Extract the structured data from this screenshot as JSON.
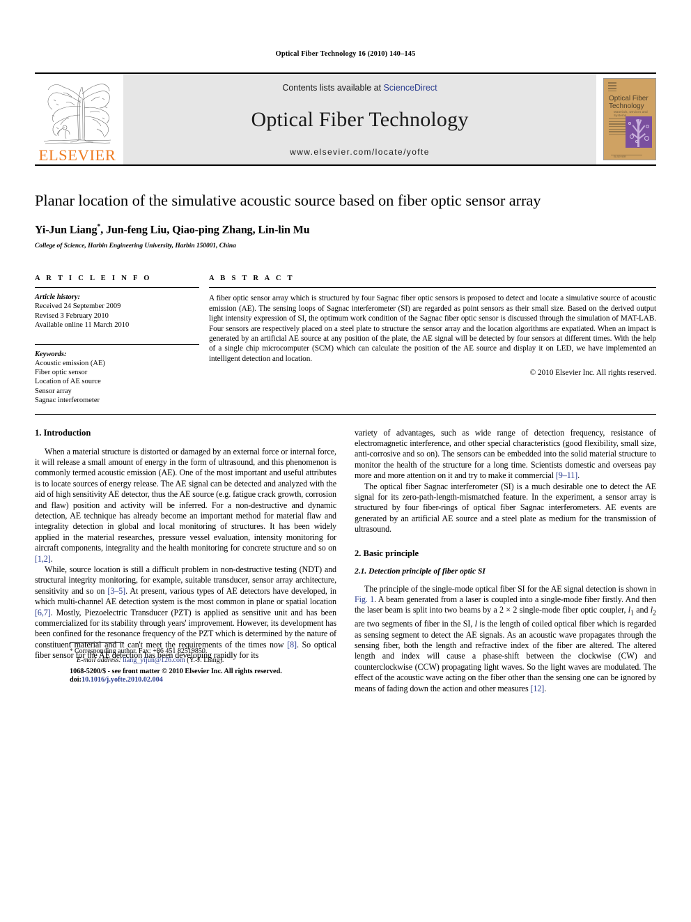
{
  "running_head": "Optical Fiber Technology 16 (2010) 140–145",
  "masthead": {
    "publisher_name": "ELSEVIER",
    "contents_prefix": "Contents lists available at ",
    "sciencedirect": "ScienceDirect",
    "journal_title": "Optical Fiber Technology",
    "journal_url": "www.elsevier.com/locate/yofte",
    "cover": {
      "title_line1": "Optical Fiber",
      "title_line2": "Technology",
      "subtitle": "Materials, Devices and Systems",
      "footer": "ELSEVIER"
    }
  },
  "article": {
    "title": "Planar location of the simulative acoustic source based on fiber optic sensor array",
    "authors": "Yi-Jun Liang *, Jun-feng Liu, Qiao-ping Zhang, Lin-lin Mu",
    "affiliation": "College of Science, Harbin Engineering University, Harbin 150001, China"
  },
  "article_info": {
    "heading": "A R T I C L E   I N F O",
    "history_label": "Article history:",
    "history": [
      "Received 24 September 2009",
      "Revised 3 February 2010",
      "Available online 11 March 2010"
    ],
    "keywords_label": "Keywords:",
    "keywords": [
      "Acoustic emission (AE)",
      "Fiber optic sensor",
      "Location of AE source",
      "Sensor array",
      "Sagnac interferometer"
    ]
  },
  "abstract": {
    "heading": "A B S T R A C T",
    "text": "A fiber optic sensor array which is structured by four Sagnac fiber optic sensors is proposed to detect and locate a simulative source of acoustic emission (AE). The sensing loops of Sagnac interferometer (SI) are regarded as point sensors as their small size. Based on the derived output light intensity expression of SI, the optimum work condition of the Sagnac fiber optic sensor is discussed through the simulation of MAT-LAB. Four sensors are respectively placed on a steel plate to structure the sensor array and the location algorithms are expatiated. When an impact is generated by an artificial AE source at any position of the plate, the AE signal will be detected by four sensors at different times. With the help of a single chip microcomputer (SCM) which can calculate the position of the AE source and display it on LED, we have implemented an intelligent detection and location.",
    "copyright": "© 2010 Elsevier Inc. All rights reserved."
  },
  "sections": {
    "introduction_heading": "1. Introduction",
    "basic_principle_heading": "2. Basic principle",
    "subsection_2_1_heading": "2.1. Detection principle of fiber optic SI"
  },
  "body": {
    "left": {
      "p1_a": "When a material structure is distorted or damaged by an external force or internal force, it will release a small amount of energy in the form of ultrasound, and this phenomenon is commonly termed acoustic emission (AE). One of the most important and useful attributes is to locate sources of energy release. The AE signal can be detected and analyzed with the aid of high sensitivity AE detector, thus the AE source (e.g. fatigue crack growth, corrosion and flaw) position and activity will be inferred. For a non-destructive and dynamic detection, AE technique has already become an important method for material flaw and integrality detection in global and local monitoring of structures. It has been widely applied in the material researches, pressure vessel evaluation, intensity monitoring for aircraft components, integrality and the health monitoring for concrete structure and so on ",
      "p1_ref": "[1,2]",
      "p1_b": ".",
      "p2_a": "While, source location is still a difficult problem in non-destructive testing (NDT) and structural integrity monitoring, for example, suitable transducer, sensor array architecture, sensitivity and so on ",
      "p2_ref1": "[3–5]",
      "p2_b": ". At present, various types of AE detectors have developed, in which multi-channel AE detection system is the most common in plane or spatial location ",
      "p2_ref2": "[6,7]",
      "p2_c": ". Mostly, Piezoelectric Transducer (PZT) is applied as sensitive unit and has been commercialized for its stability through years' improvement. However, its development has been confined for the resonance frequency of the PZT which is determined by the nature of constituent material and it can't meet the requirements of the times now ",
      "p2_ref3": "[8]",
      "p2_d": ". So optical fiber sensor for the AE detection has been developing rapidly for its"
    },
    "right": {
      "p1_a": "variety of advantages, such as wide range of detection frequency, resistance of electromagnetic interference, and other special characteristics (good flexibility, small size, anti-corrosive and so on). The sensors can be embedded into the solid material structure to monitor the health of the structure for a long time. Scientists domestic and overseas pay more and more attention on it and try to make it commercial ",
      "p1_ref": "[9–11]",
      "p1_b": ".",
      "p2": "The optical fiber Sagnac interferometer (SI) is a much desirable one to detect the AE signal for its zero-path-length-mismatched feature. In the experiment, a sensor array is structured by four fiber-rings of optical fiber Sagnac interferometers. AE events are generated by an artificial AE source and a steel plate as medium for the transmission of ultrasound.",
      "p3_a": "The principle of the single-mode optical fiber SI for the AE signal detection is shown in ",
      "p3_fig": "Fig. 1",
      "p3_b": ". A beam generated from a laser is coupled into a single-mode fiber firstly. And then the laser beam is split into two beams by a 2 × 2 single-mode fiber optic coupler, ",
      "p3_l1": "l",
      "p3_sub1": "1",
      "p3_c": " and ",
      "p3_l2": "l",
      "p3_sub2": "2",
      "p3_d": " are two segments of fiber in the SI, ",
      "p3_l3": "l",
      "p3_e": " is the length of coiled optical fiber which is regarded as sensing segment to detect the AE signals. As an acoustic wave propagates through the sensing fiber, both the length and refractive index of the fiber are altered. The altered length and index will cause a phase-shift between the clockwise (CW) and counterclockwise (CCW) propagating light waves. So the light waves are modulated. The effect of the acoustic wave acting on the fiber other than the sensing one can be ignored by means of fading down the action and other measures ",
      "p3_ref": "[12]",
      "p3_f": "."
    }
  },
  "footnote": {
    "star": "*",
    "corresponding": " Corresponding author. Fax: +86 451 82519850.",
    "email_label": "E-mail address:",
    "email": "liang_yijun@126.com",
    "email_suffix": " (Y.-J. Liang)."
  },
  "footer": {
    "line1": "1068-5200/$ - see front matter © 2010 Elsevier Inc. All rights reserved.",
    "doi_label": "doi:",
    "doi_value": "10.1016/j.yofte.2010.02.004"
  },
  "colors": {
    "link": "#2b3d8f",
    "elsevier_orange": "#ee7c22",
    "banner_bg": "#e6e6e6",
    "cover_bg": "#cfa263",
    "cover_art": "#7a4f9e"
  }
}
